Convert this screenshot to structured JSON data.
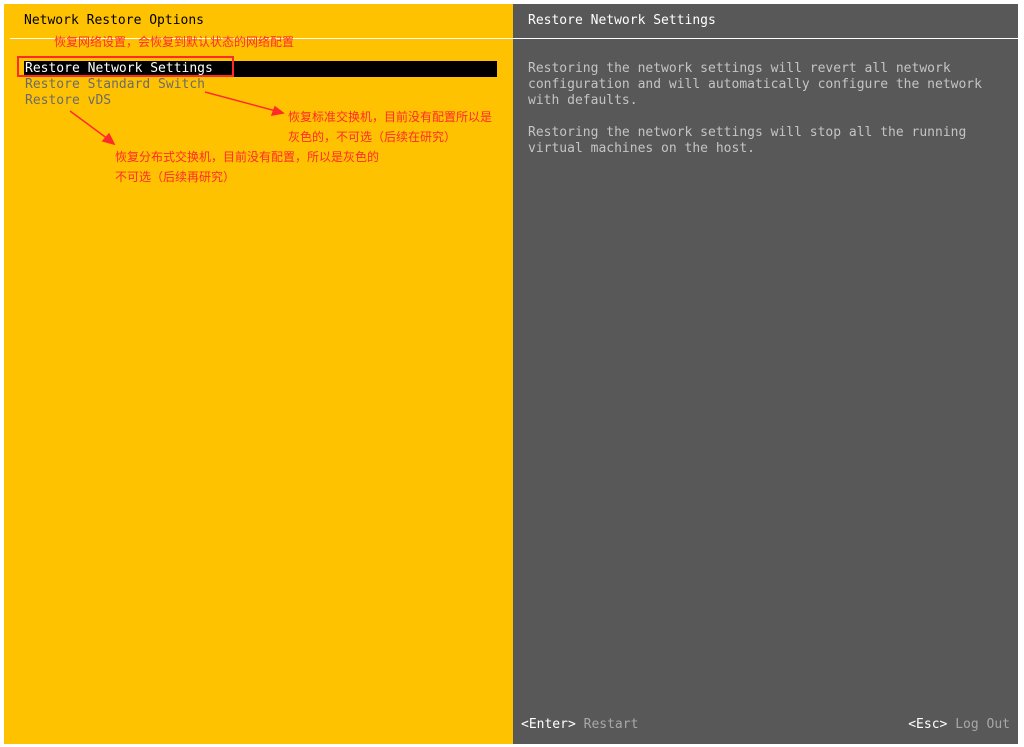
{
  "left_panel": {
    "title": "Network Restore Options",
    "menu_items": [
      {
        "label": "Restore Network Settings",
        "state": "selected"
      },
      {
        "label": "Restore Standard Switch",
        "state": "disabled"
      },
      {
        "label": "Restore vDS",
        "state": "disabled"
      }
    ]
  },
  "right_panel": {
    "title": "Restore Network Settings",
    "paragraphs": [
      "Restoring the network settings will revert all network\nconfiguration and will automatically configure the network\nwith defaults.",
      "Restoring the network settings will stop all the running\nvirtual machines on the host."
    ]
  },
  "footer": {
    "enter_key": "<Enter>",
    "enter_action": "Restart",
    "esc_key": "<Esc>",
    "esc_action": "Log Out"
  },
  "annotations": {
    "note_restore_network": "恢复网络设置，会恢复到默认状态的网络配置",
    "note_standard_switch_1": "恢复标准交换机，目前没有配置所以是",
    "note_standard_switch_2": "灰色的，不可选（后续在研究）",
    "note_vds_1": "恢复分布式交换机，目前没有配置，所以是灰色的",
    "note_vds_2": "不可选（后续再研究）"
  },
  "colors": {
    "left_panel_bg": "#ffc200",
    "right_panel_bg": "#585858",
    "annotation": "#ff2a2a"
  }
}
